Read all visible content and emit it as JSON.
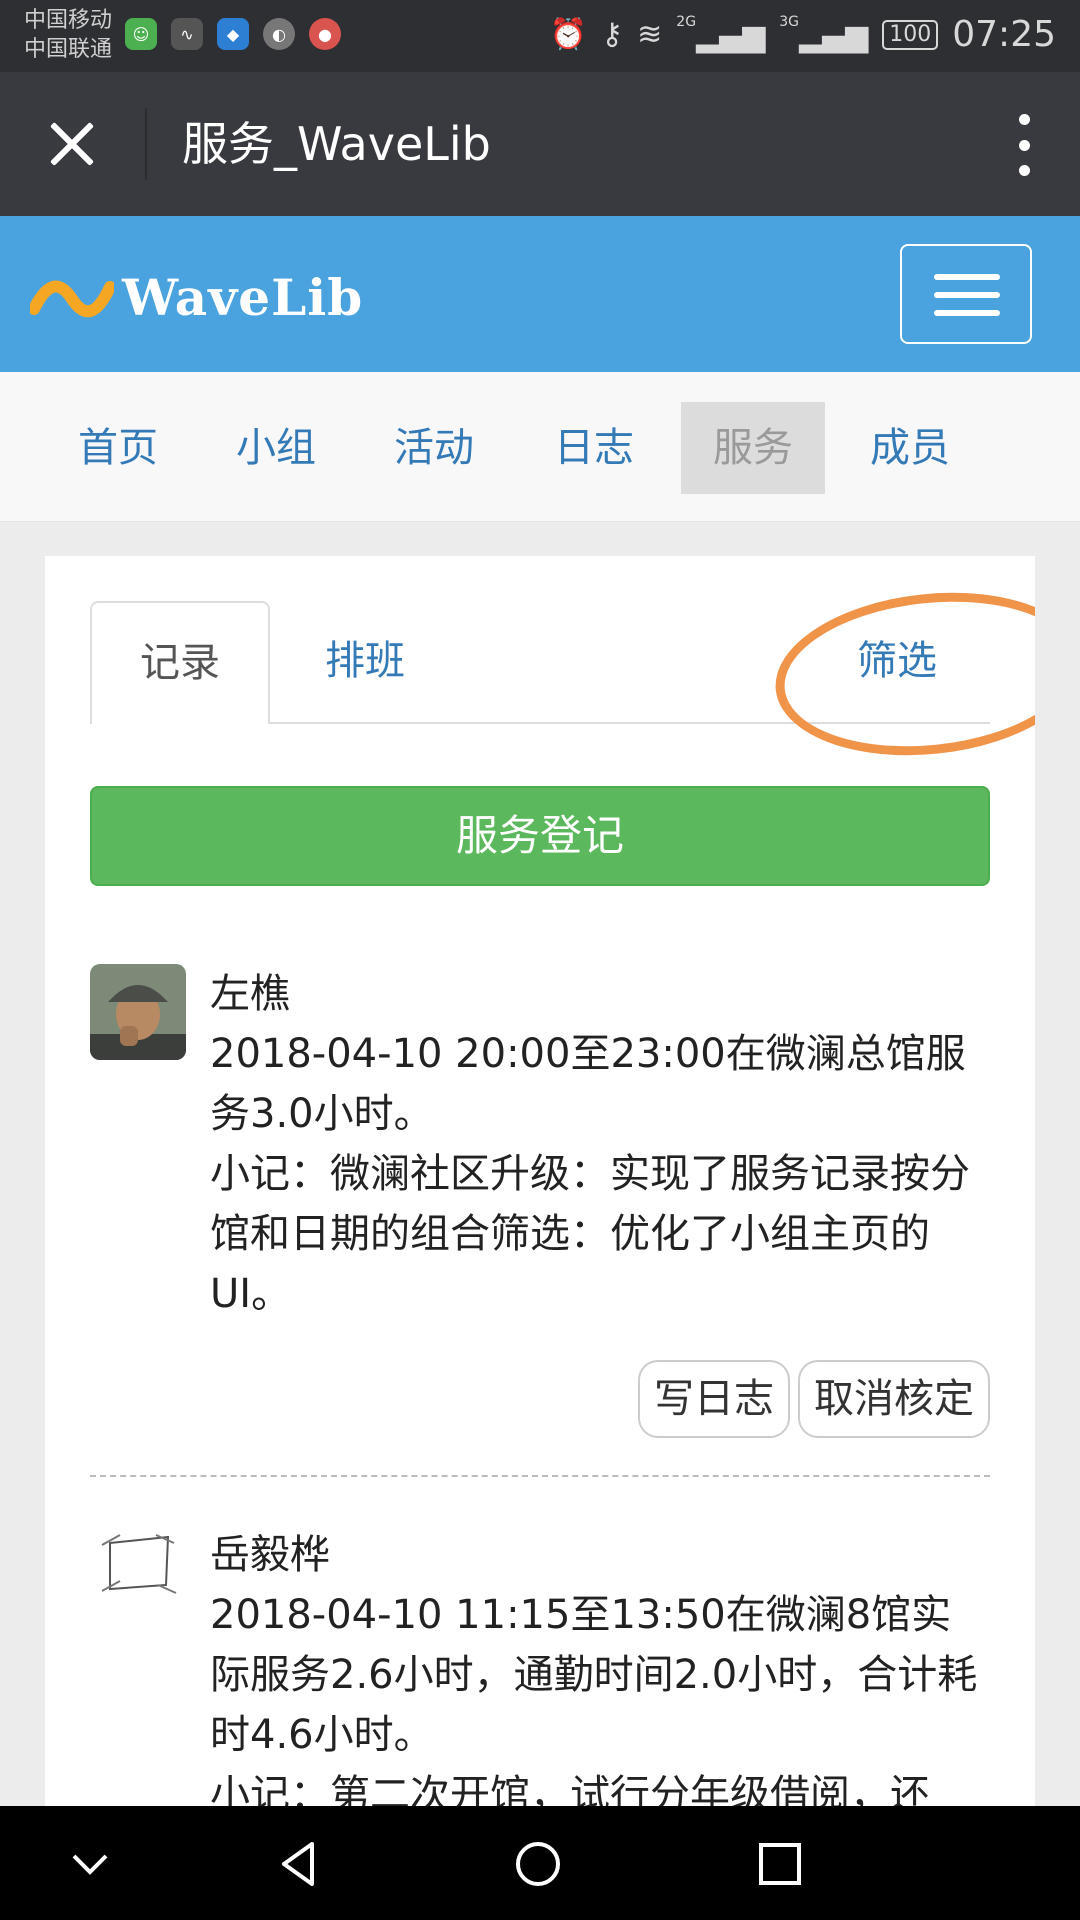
{
  "status_bar": {
    "carrier_1": "中国移动",
    "carrier_2": "中国联通",
    "net_1": "2G",
    "net_2": "3G",
    "battery": "100",
    "time": "07:25"
  },
  "title_bar": {
    "title": "服务_WaveLib"
  },
  "site_header": {
    "logo_text": "WaveLib",
    "brand_color": "#4aa3df"
  },
  "nav": {
    "items": [
      {
        "label": "首页"
      },
      {
        "label": "小组"
      },
      {
        "label": "活动"
      },
      {
        "label": "日志"
      },
      {
        "label": "服务",
        "active": true
      },
      {
        "label": "成员"
      }
    ]
  },
  "tabs": {
    "record": "记录",
    "schedule": "排班",
    "filter": "筛选"
  },
  "register_button": "服务登记",
  "records": [
    {
      "name": "左樵",
      "line1": "2018-04-10 20:00至23:00在微澜总馆服务3.0小时。",
      "note": "小记：微澜社区升级：实现了服务记录按分馆和日期的组合筛选：优化了小组主页的UI。",
      "actions": [
        "写日志",
        "取消核定"
      ]
    },
    {
      "name": "岳毅桦",
      "line1": "2018-04-10 11:15至13:50在微澜8馆实际服务2.6小时，通勤时间2.0小时，合计耗时4.6小时。",
      "note": "小记：第二次开馆，试行分年级借阅，还"
    }
  ],
  "colors": {
    "accent_green": "#5cb85c",
    "link_blue": "#337ab7",
    "annotation_orange": "#f0944a"
  }
}
